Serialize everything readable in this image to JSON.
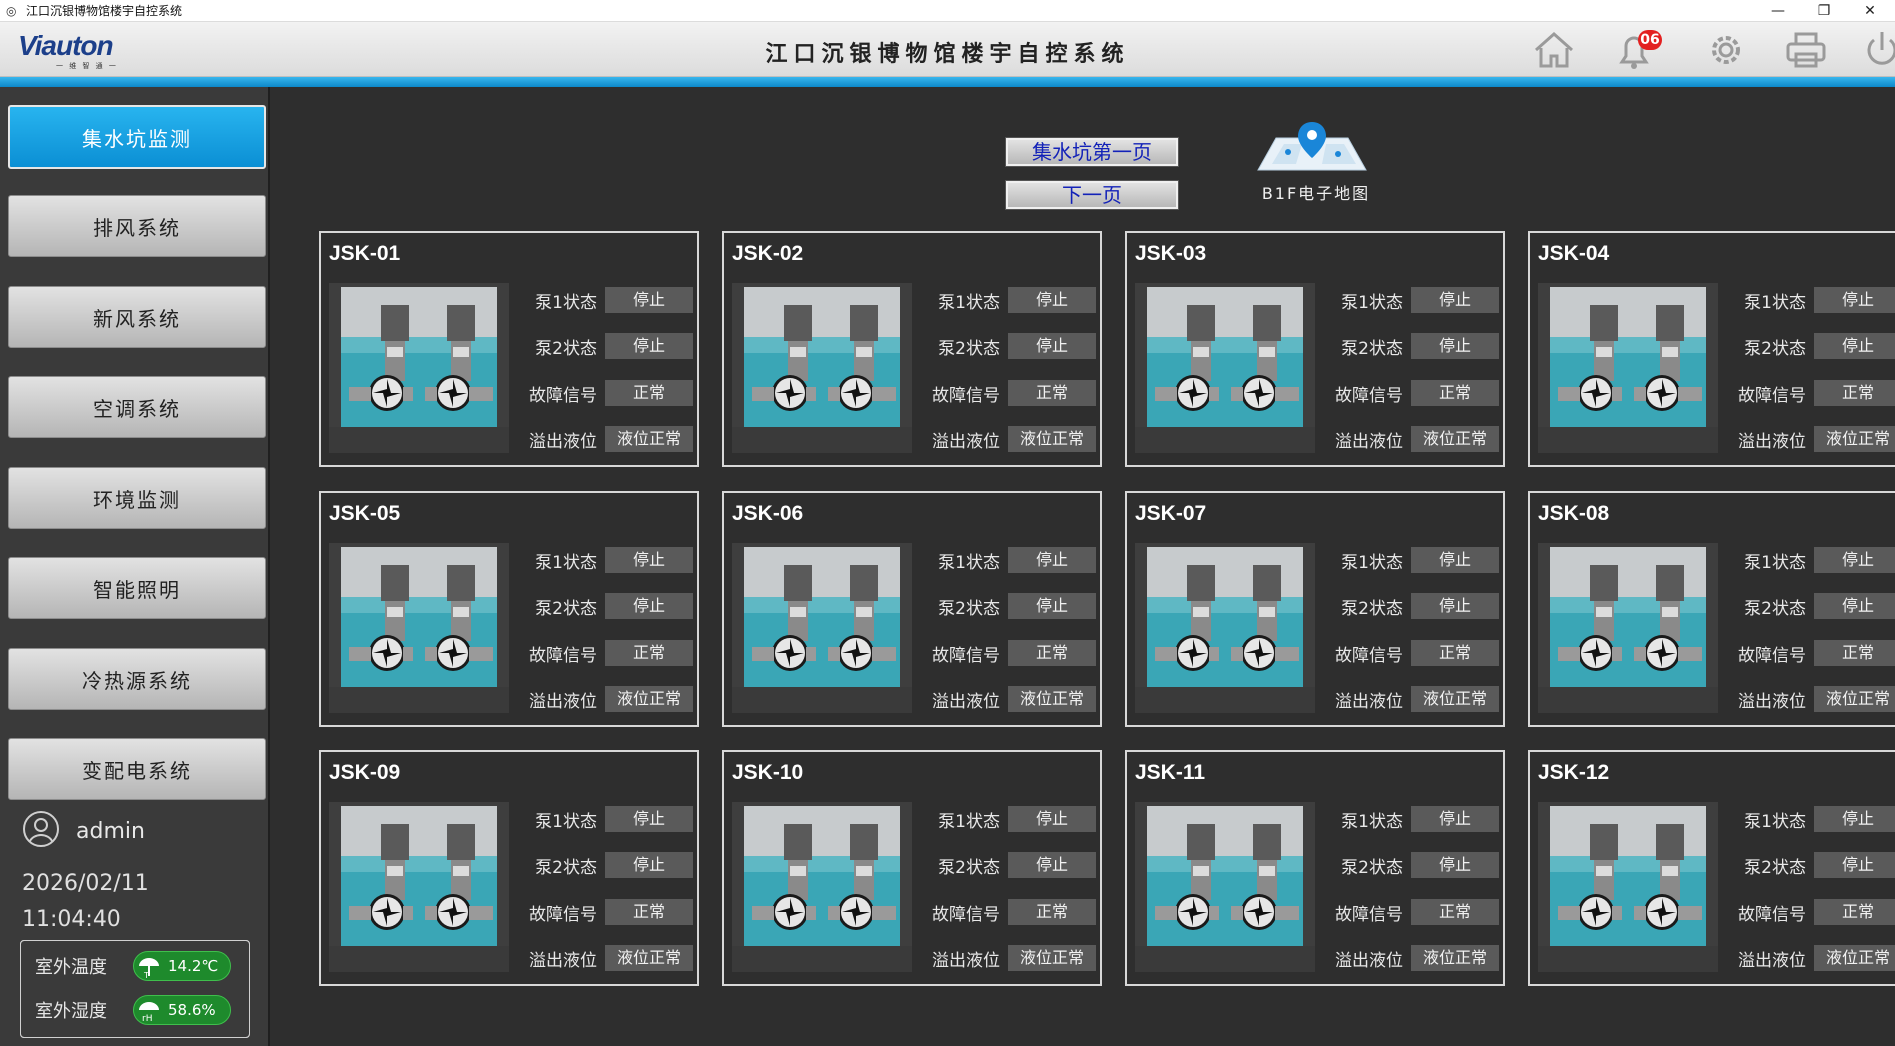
{
  "window": {
    "title": "江口沉银博物馆楼宇自控系统",
    "controls": [
      "—",
      "❐",
      "✕"
    ]
  },
  "header": {
    "logo_text": "Viauton",
    "logo_sub": "一 维 智 通 一",
    "title": "江口沉银博物馆楼宇自控系统",
    "alarm_count": "06",
    "icons": [
      "home-icon",
      "bell-icon",
      "gear-icon",
      "printer-icon",
      "power-icon"
    ]
  },
  "sidebar": {
    "items": [
      {
        "label": "集水坑监测",
        "active": true
      },
      {
        "label": "排风系统",
        "active": false
      },
      {
        "label": "新风系统",
        "active": false
      },
      {
        "label": "空调系统",
        "active": false
      },
      {
        "label": "环境监测",
        "active": false
      },
      {
        "label": "智能照明",
        "active": false
      },
      {
        "label": "冷热源系统",
        "active": false
      },
      {
        "label": "变配电系统",
        "active": false
      }
    ],
    "user": "admin",
    "date": "2026/02/11",
    "time": "11:04:40",
    "weather": {
      "temp_label": "室外温度",
      "temp_value": "14.2℃",
      "humidity_label": "室外湿度",
      "humidity_value": "58.6%"
    }
  },
  "main": {
    "page_button_1": "集水坑第一页",
    "page_button_2": "下一页",
    "map_label": "B1F电子地图",
    "labels": {
      "pump1": "泵1状态",
      "pump2": "泵2状态",
      "fault": "故障信号",
      "overflow": "溢出液位"
    },
    "pits": [
      {
        "id": "JSK-01",
        "pump1": "停止",
        "pump2": "停止",
        "fault": "正常",
        "overflow": "液位正常"
      },
      {
        "id": "JSK-02",
        "pump1": "停止",
        "pump2": "停止",
        "fault": "正常",
        "overflow": "液位正常"
      },
      {
        "id": "JSK-03",
        "pump1": "停止",
        "pump2": "停止",
        "fault": "正常",
        "overflow": "液位正常"
      },
      {
        "id": "JSK-04",
        "pump1": "停止",
        "pump2": "停止",
        "fault": "正常",
        "overflow": "液位正常"
      },
      {
        "id": "JSK-05",
        "pump1": "停止",
        "pump2": "停止",
        "fault": "正常",
        "overflow": "液位正常"
      },
      {
        "id": "JSK-06",
        "pump1": "停止",
        "pump2": "停止",
        "fault": "正常",
        "overflow": "液位正常"
      },
      {
        "id": "JSK-07",
        "pump1": "停止",
        "pump2": "停止",
        "fault": "正常",
        "overflow": "液位正常"
      },
      {
        "id": "JSK-08",
        "pump1": "停止",
        "pump2": "停止",
        "fault": "正常",
        "overflow": "液位正常"
      },
      {
        "id": "JSK-09",
        "pump1": "停止",
        "pump2": "停止",
        "fault": "正常",
        "overflow": "液位正常"
      },
      {
        "id": "JSK-10",
        "pump1": "停止",
        "pump2": "停止",
        "fault": "正常",
        "overflow": "液位正常"
      },
      {
        "id": "JSK-11",
        "pump1": "停止",
        "pump2": "停止",
        "fault": "正常",
        "overflow": "液位正常"
      },
      {
        "id": "JSK-12",
        "pump1": "停止",
        "pump2": "停止",
        "fault": "正常",
        "overflow": "液位正常"
      }
    ]
  },
  "colors": {
    "accent_blue": "#0d88c8",
    "background": "#2e2e2e",
    "status_green": "#1e8a2c",
    "alarm_red": "#e32020"
  }
}
